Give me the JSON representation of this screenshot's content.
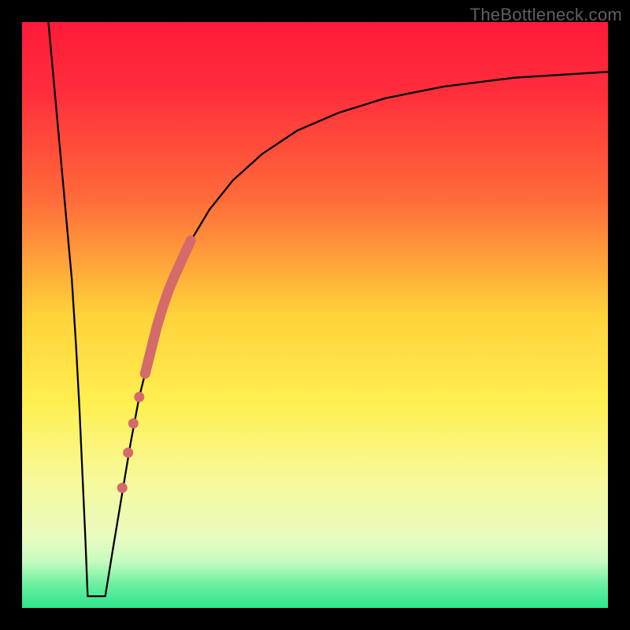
{
  "watermark": "TheBottleneck.com",
  "chart_data": {
    "type": "line",
    "title": "",
    "xlabel": "",
    "ylabel": "",
    "xlim": [
      0,
      100
    ],
    "ylim": [
      0,
      100
    ],
    "gradient_stops": [
      {
        "offset": 0.0,
        "color": "#ff1a3a"
      },
      {
        "offset": 0.12,
        "color": "#ff2e3b"
      },
      {
        "offset": 0.3,
        "color": "#ff6a3a"
      },
      {
        "offset": 0.5,
        "color": "#ffd23a"
      },
      {
        "offset": 0.65,
        "color": "#ffef50"
      },
      {
        "offset": 0.78,
        "color": "#f7f99a"
      },
      {
        "offset": 0.88,
        "color": "#e9fbc0"
      },
      {
        "offset": 0.92,
        "color": "#c7fbc0"
      },
      {
        "offset": 0.96,
        "color": "#6af0a0"
      },
      {
        "offset": 1.0,
        "color": "#2de58c"
      }
    ],
    "series": [
      {
        "name": "left-descent",
        "x": [
          4.5,
          5.5,
          6.5,
          7.5,
          8.5,
          9.2,
          9.8,
          10.3,
          10.8,
          11.2
        ],
        "y": [
          100,
          89,
          78,
          67,
          56,
          45,
          34,
          23,
          12,
          2
        ]
      },
      {
        "name": "floor",
        "x": [
          11.2,
          12.2,
          13.2,
          14.2
        ],
        "y": [
          2,
          2,
          2,
          2
        ]
      },
      {
        "name": "right-ascent",
        "x": [
          14.2,
          15.5,
          17.0,
          18.5,
          20.0,
          22.0,
          24.0,
          26.5,
          29.0,
          32.0,
          36.0,
          41.0,
          47.0,
          54.0,
          62.0,
          72.0,
          84.0,
          100.0
        ],
        "y": [
          2,
          10,
          19,
          28,
          36,
          44,
          51,
          57,
          63,
          68,
          73,
          77.5,
          81.5,
          84.5,
          87,
          89,
          90.5,
          91.5
        ]
      }
    ],
    "highlight_segment": {
      "name": "highlight-thick",
      "color": "#d46a6a",
      "x": [
        21.0,
        22.0,
        23.0,
        24.0,
        25.0,
        26.0,
        27.0,
        28.0,
        28.8
      ],
      "y": [
        40.0,
        44.0,
        48.0,
        51.3,
        54.2,
        56.6,
        58.8,
        61.0,
        62.7
      ]
    },
    "highlight_dots": {
      "name": "highlight-dots",
      "color": "#d46a6a",
      "x": [
        20.0,
        19.0,
        18.1,
        17.1
      ],
      "y": [
        36.0,
        31.5,
        26.5,
        20.5
      ]
    }
  }
}
